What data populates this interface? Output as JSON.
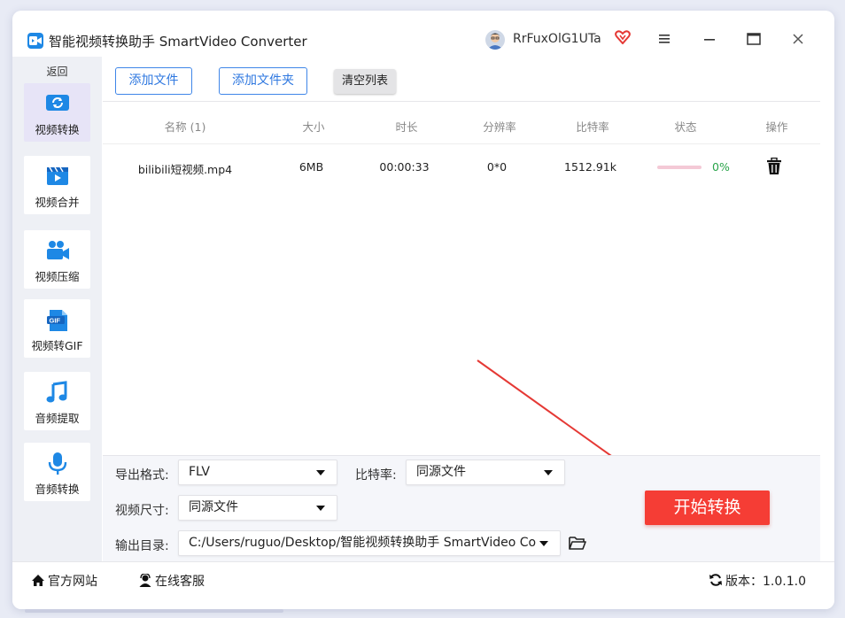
{
  "window": {
    "title": "智能视频转换助手 SmartVideo Converter",
    "username": "RrFuxOlG1UTa"
  },
  "sidebar": {
    "back_label": "返回",
    "items": [
      {
        "label": "视频转换",
        "icon": "video-convert-icon",
        "active": true
      },
      {
        "label": "视频合并",
        "icon": "video-merge-icon",
        "active": false
      },
      {
        "label": "视频压缩",
        "icon": "video-compress-icon",
        "active": false
      },
      {
        "label": "视频转GIF",
        "icon": "gif-icon",
        "active": false
      },
      {
        "label": "音频提取",
        "icon": "music-note-icon",
        "active": false
      },
      {
        "label": "音频转换",
        "icon": "microphone-icon",
        "active": false
      }
    ]
  },
  "toolbar": {
    "add_file": "添加文件",
    "add_folder": "添加文件夹",
    "clear_list": "清空列表"
  },
  "table": {
    "columns": [
      "名称 (1)",
      "大小",
      "时长",
      "分辨率",
      "比特率",
      "状态",
      "操作"
    ],
    "rows": [
      {
        "name": "bilibili短视频.mp4",
        "size": "6MB",
        "duration": "00:00:33",
        "resolution": "0*0",
        "bitrate": "1512.91k",
        "progress": "0%",
        "progress_value": 0
      }
    ]
  },
  "settings": {
    "format_label": "导出格式:",
    "format_value": "FLV",
    "bitrate_label": "比特率:",
    "bitrate_value": "同源文件",
    "size_label": "视频尺寸:",
    "size_value": "同源文件",
    "output_label": "输出目录:",
    "output_value": "C:/Users/ruguo/Desktop/智能视频转换助手 SmartVideo Co",
    "start_button": "开始转换"
  },
  "footer": {
    "website": "官方网站",
    "support": "在线客服",
    "version": "版本：1.0.1.0"
  },
  "colors": {
    "accent": "#3f86e8",
    "start_button": "#f53d35",
    "progress_text": "#2aa44a",
    "sidebar_bg": "#eef0f5"
  }
}
